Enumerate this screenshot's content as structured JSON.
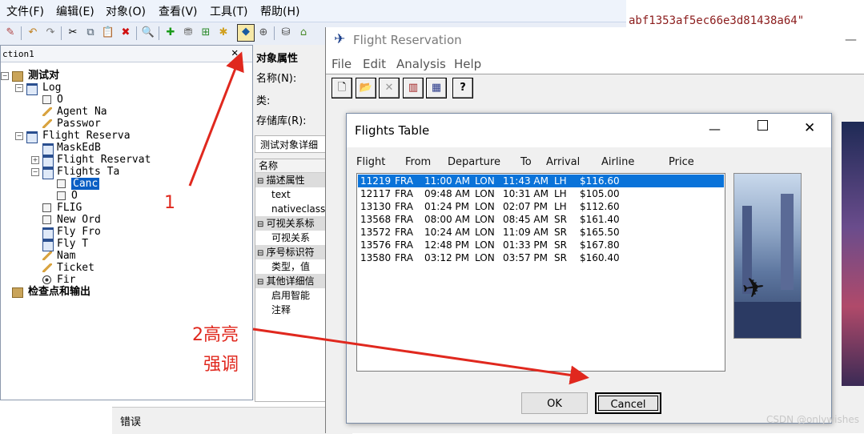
{
  "qtp": {
    "menu": [
      "文件(F)",
      "编辑(E)",
      "对象(O)",
      "查看(V)",
      "工具(T)",
      "帮助(H)"
    ],
    "action_tab": "ction1",
    "hex_string": "abf1353af5ec66e3d81438a64\"",
    "tree": [
      {
        "label": "测试对",
        "depth": 0
      },
      {
        "label": "Log",
        "depth": 1
      },
      {
        "label": "O",
        "depth": 2
      },
      {
        "label": "Agent Na",
        "depth": 2
      },
      {
        "label": "Passwor",
        "depth": 2
      },
      {
        "label": "Flight Reserva",
        "depth": 1
      },
      {
        "label": "MaskEdB",
        "depth": 2
      },
      {
        "label": "Flight Reservat",
        "depth": 2
      },
      {
        "label": "Flights Ta",
        "depth": 2
      },
      {
        "label": "Canc",
        "depth": 3
      },
      {
        "label": "O",
        "depth": 3
      },
      {
        "label": "FLIG",
        "depth": 2
      },
      {
        "label": "New Ord",
        "depth": 2
      },
      {
        "label": "Fly Fro",
        "depth": 2
      },
      {
        "label": "Fly T",
        "depth": 2
      },
      {
        "label": "Nam",
        "depth": 2
      },
      {
        "label": "Ticket",
        "depth": 2
      },
      {
        "label": "Fir",
        "depth": 2
      },
      {
        "label": "检查点和输出",
        "depth": 0
      }
    ],
    "properties": {
      "title": "对象属性",
      "name_label": "名称(N):",
      "class_label": "类:",
      "repo_label": "存储库(R):",
      "details_tab": "测试对象详细",
      "col_name": "名称",
      "rows": [
        "描述属性",
        "text",
        "nativeclass",
        "可视关系标",
        "可视关系",
        "序号标识符",
        "类型，值",
        "其他详细信",
        "启用智能",
        "注释"
      ]
    },
    "error_tab": "错误"
  },
  "fr": {
    "title": "Flight Reservation",
    "menu": [
      "File",
      "Edit",
      "Analysis",
      "Help"
    ]
  },
  "dialog": {
    "title": "Flights Table",
    "headers": [
      "Flight",
      "From",
      "Departure",
      "To",
      "Arrival",
      "Airline",
      "Price"
    ],
    "rows": [
      [
        "11219",
        "FRA",
        "11:00 AM",
        "LON",
        "11:43 AM",
        "LH",
        "$116.60"
      ],
      [
        "12117",
        "FRA",
        "09:48 AM",
        "LON",
        "10:31 AM",
        "LH",
        "$105.00"
      ],
      [
        "13130",
        "FRA",
        "01:24 PM",
        "LON",
        "02:07 PM",
        "LH",
        "$112.60"
      ],
      [
        "13568",
        "FRA",
        "08:00 AM",
        "LON",
        "08:45 AM",
        "SR",
        "$161.40"
      ],
      [
        "13572",
        "FRA",
        "10:24 AM",
        "LON",
        "11:09 AM",
        "SR",
        "$165.50"
      ],
      [
        "13576",
        "FRA",
        "12:48 PM",
        "LON",
        "01:33 PM",
        "SR",
        "$167.80"
      ],
      [
        "13580",
        "FRA",
        "03:12 PM",
        "LON",
        "03:57 PM",
        "SR",
        "$160.40"
      ]
    ],
    "selected_row": 0,
    "ok_label": "OK",
    "cancel_label": "Cancel"
  },
  "annotations": {
    "one": "1",
    "two_line1": "2高亮",
    "two_line2": "强调",
    "color": "#e0281e"
  },
  "watermark": "CSDN @onlywishes"
}
